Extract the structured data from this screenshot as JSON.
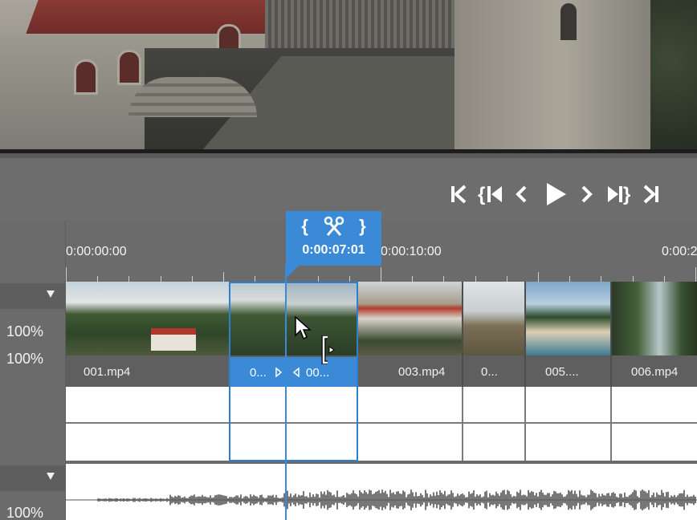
{
  "transport": {
    "go_start": "go-to-start",
    "prev_mark": "previous-marker",
    "prev_frame": "previous-frame",
    "play": "play",
    "next_frame": "next-frame",
    "next_mark": "next-marker",
    "go_end": "go-to-end"
  },
  "ruler": {
    "labels": [
      "0:00:00:00",
      "0:00:10:00",
      "0:00:2"
    ]
  },
  "playhead": {
    "time": "0:00:07:01",
    "bracket_left": "{",
    "bracket_right": "}"
  },
  "tracks": {
    "video_opacity": "100%",
    "video_volume": "100%",
    "audio_volume": "100%"
  },
  "clips": [
    {
      "label": "001.mp4"
    },
    {
      "label": "0..."
    },
    {
      "label": "00..."
    },
    {
      "label": "003.mp4"
    },
    {
      "label": "0..."
    },
    {
      "label": "005...."
    },
    {
      "label": "006.mp4"
    }
  ],
  "colors": {
    "accent": "#3a8ad8",
    "panel": "#6b6b6b"
  }
}
